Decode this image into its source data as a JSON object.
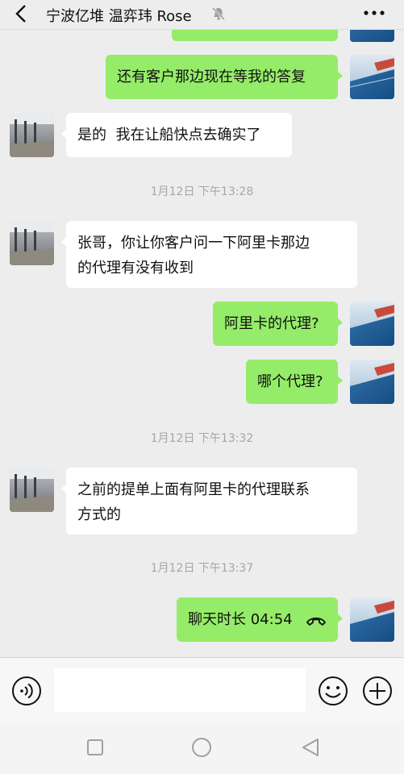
{
  "header": {
    "title": "宁波亿堆 温弈玮 Rose",
    "back_icon": "chevron-left-icon",
    "mute_icon": "bell-off-icon",
    "more_icon": "ellipsis-icon"
  },
  "messages": [
    {
      "sender": "me",
      "text": "还有客户那边现在等我的答复"
    },
    {
      "sender": "other",
      "text": "是的  我在让船快点去确实了"
    },
    {
      "type": "time",
      "text": "1月12日 下午13:28"
    },
    {
      "sender": "other",
      "lines": [
        "张哥，你让你客户问一下阿里卡那边",
        "的代理有没有收到"
      ]
    },
    {
      "sender": "me",
      "text": "阿里卡的代理?"
    },
    {
      "sender": "me",
      "text": "哪个代理?"
    },
    {
      "type": "time",
      "text": "1月12日 下午13:32"
    },
    {
      "sender": "other",
      "lines": [
        "之前的提单上面有阿里卡的代理联系",
        "方式的"
      ]
    },
    {
      "type": "time",
      "text": "1月12日 下午13:37"
    },
    {
      "sender": "me",
      "type": "call",
      "text": "聊天时长 04:54",
      "icon": "phone-hangup-icon"
    }
  ],
  "input": {
    "value": "",
    "voice_icon": "voice-icon",
    "emoji_icon": "emoji-icon",
    "plus_icon": "plus-icon"
  },
  "nav": {
    "recent_icon": "square-icon",
    "home_icon": "circle-icon",
    "back_icon": "triangle-back-icon"
  },
  "colors": {
    "my_bubble": "#95ec69",
    "other_bubble": "#ffffff",
    "background": "#ededed"
  }
}
